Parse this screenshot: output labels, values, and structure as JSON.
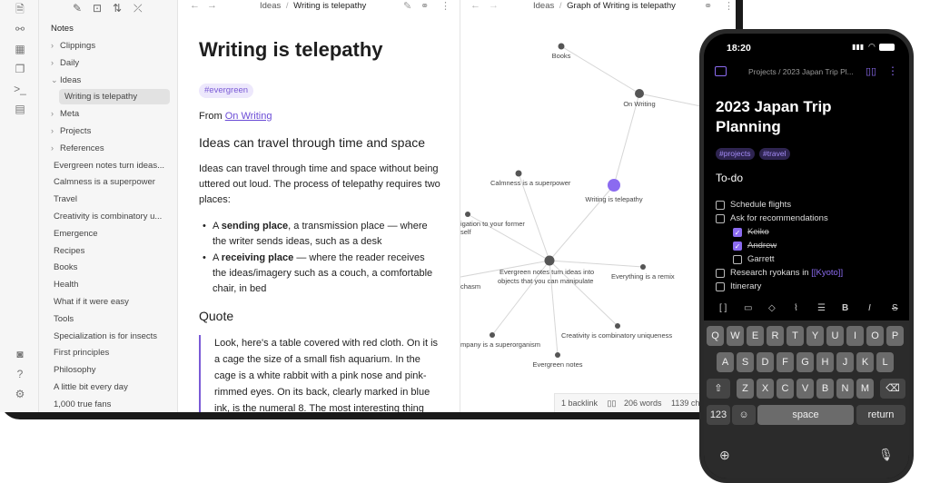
{
  "sidebar": {
    "section_label": "Notes",
    "items": [
      {
        "label": "Clippings",
        "type": "folder",
        "expanded": false
      },
      {
        "label": "Daily",
        "type": "folder",
        "expanded": false
      },
      {
        "label": "Ideas",
        "type": "folder",
        "expanded": true
      },
      {
        "label": "Writing is telepathy",
        "type": "file",
        "active": true
      },
      {
        "label": "Meta",
        "type": "folder",
        "expanded": false
      },
      {
        "label": "Projects",
        "type": "folder",
        "expanded": false
      },
      {
        "label": "References",
        "type": "folder",
        "expanded": false
      },
      {
        "label": "Evergreen notes turn ideas...",
        "type": "file"
      },
      {
        "label": "Calmness is a superpower",
        "type": "file"
      },
      {
        "label": "Travel",
        "type": "file"
      },
      {
        "label": "Creativity is combinatory u...",
        "type": "file"
      },
      {
        "label": "Emergence",
        "type": "file"
      },
      {
        "label": "Recipes",
        "type": "file"
      },
      {
        "label": "Books",
        "type": "file"
      },
      {
        "label": "Health",
        "type": "file"
      },
      {
        "label": "What if it were easy",
        "type": "file"
      },
      {
        "label": "Tools",
        "type": "file"
      },
      {
        "label": "Specialization is for insects",
        "type": "file"
      },
      {
        "label": "First principles",
        "type": "file"
      },
      {
        "label": "Philosophy",
        "type": "file"
      },
      {
        "label": "A little bit every day",
        "type": "file"
      },
      {
        "label": "1,000 true fans",
        "type": "file"
      }
    ]
  },
  "editor": {
    "breadcrumb_folder": "Ideas",
    "breadcrumb_sep": "/",
    "breadcrumb_file": "Writing is telepathy",
    "title": "Writing is telepathy",
    "tag": "#evergreen",
    "from_prefix": "From",
    "from_link": "On Writing",
    "heading1": "Ideas can travel through time and space",
    "para1": "Ideas can travel through time and space without being uttered out loud. The process of telepathy requires two places:",
    "bullets": [
      {
        "pre": "A ",
        "bold": "sending place",
        "post": ", a transmission place — where the writer sends ideas, such as a desk"
      },
      {
        "pre": "A ",
        "bold": "receiving place",
        "post": " — where the reader receives the ideas/imagery such as a couch, a comfortable chair, in bed"
      }
    ],
    "heading2": "Quote",
    "quote": "Look, here's a table covered with red cloth. On it is a cage the size of a small fish aquarium. In the cage is a white rabbit with a pink nose and pink-rimmed eyes. On its back, clearly marked in blue ink, is the numeral 8. The most interesting thing"
  },
  "graph": {
    "breadcrumb_folder": "Ideas",
    "breadcrumb_sep": "/",
    "breadcrumb_file": "Graph of Writing is telepathy",
    "nodes": [
      {
        "id": "books",
        "label": "Books"
      },
      {
        "id": "onwriting",
        "label": "On Writing"
      },
      {
        "id": "calm",
        "label": "Calmness is a superpower"
      },
      {
        "id": "wit",
        "label": "Writing is telepathy"
      },
      {
        "id": "nav",
        "label": "igation to your former self"
      },
      {
        "id": "ever",
        "label": "Evergreen notes turn ideas into objects that you can manipulate"
      },
      {
        "id": "remix",
        "label": "Everything is a remix"
      },
      {
        "id": "chasm",
        "label": "chasm"
      },
      {
        "id": "company",
        "label": "mpany is a superorganism"
      },
      {
        "id": "creat",
        "label": "Creativity is combinatory uniqueness"
      },
      {
        "id": "evn",
        "label": "Evergreen notes"
      }
    ]
  },
  "statusbar": {
    "backlinks": "1 backlink",
    "words": "206 words",
    "chars": "1139 char"
  },
  "phone": {
    "time": "18:20",
    "breadcrumb": "Projects / 2023 Japan Trip Pl...",
    "title": "2023 Japan Trip Planning",
    "tags": [
      "#projects",
      "#travel"
    ],
    "section": "To-do",
    "todos": [
      {
        "text": "Schedule flights",
        "checked": false,
        "indent": 0
      },
      {
        "text": "Ask for recommendations",
        "checked": false,
        "indent": 0
      },
      {
        "text": "Keiko",
        "checked": true,
        "indent": 1
      },
      {
        "text": "Andrew",
        "checked": true,
        "indent": 1
      },
      {
        "text": "Garrett",
        "checked": false,
        "indent": 1
      },
      {
        "text": "Research ryokans in ",
        "checked": false,
        "indent": 0,
        "link": "[[Kyoto]]"
      },
      {
        "text": "Itinerary",
        "checked": false,
        "indent": 0
      }
    ],
    "keyboard": {
      "row1": [
        "Q",
        "W",
        "E",
        "R",
        "T",
        "Y",
        "U",
        "I",
        "O",
        "P"
      ],
      "row2": [
        "A",
        "S",
        "D",
        "F",
        "G",
        "H",
        "J",
        "K",
        "L"
      ],
      "row3": [
        "Z",
        "X",
        "C",
        "V",
        "B",
        "N",
        "M"
      ],
      "num_key": "123",
      "space": "space",
      "return": "return"
    }
  },
  "colors": {
    "accent": "#7a5ad6",
    "phone_accent": "#8b6bf0"
  }
}
